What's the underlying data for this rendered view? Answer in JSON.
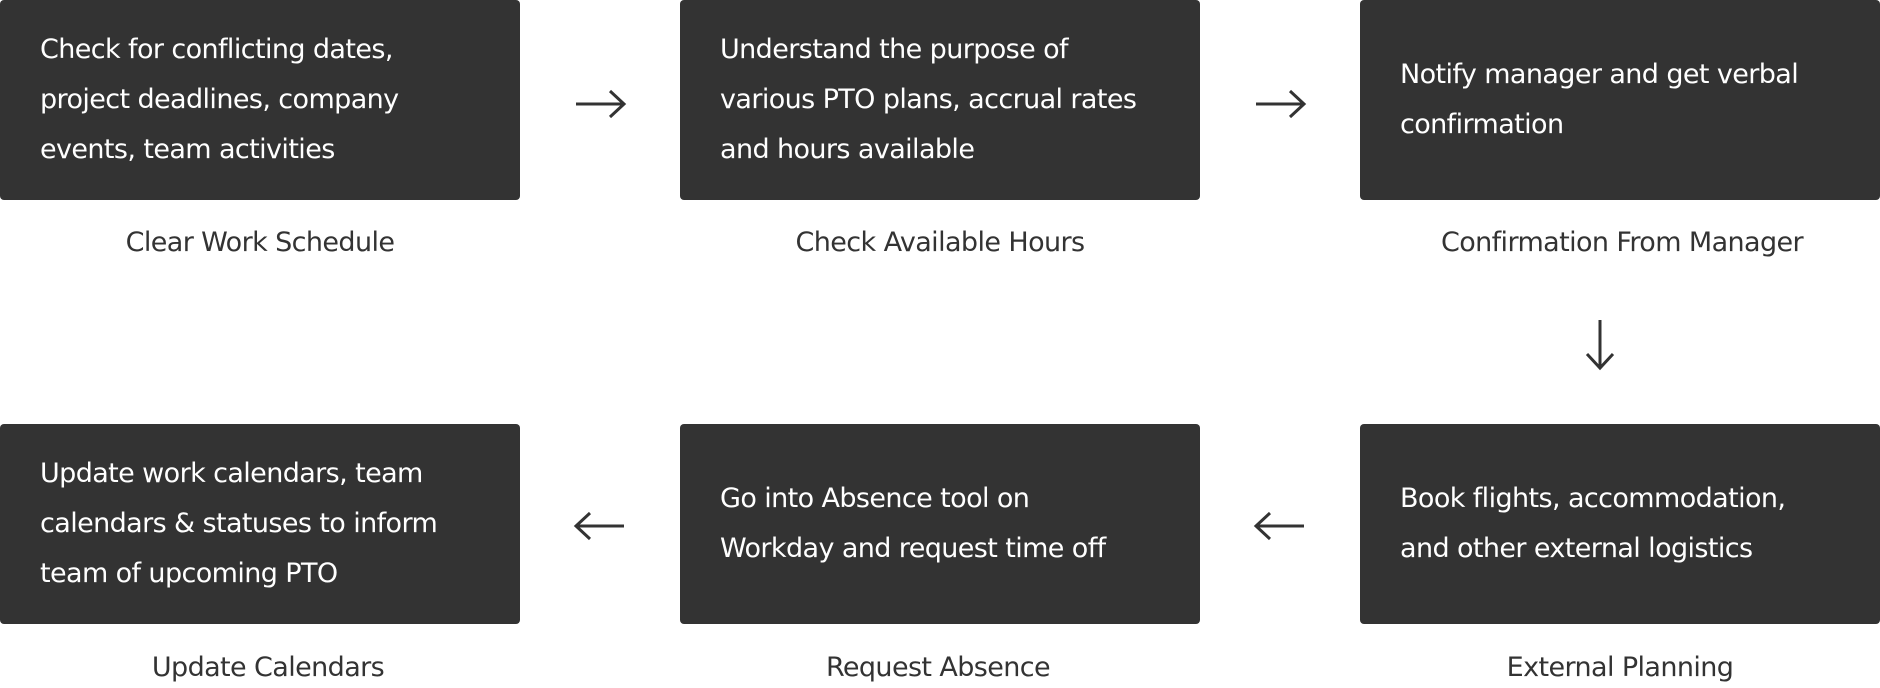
{
  "steps": [
    {
      "title": "Clear Work Schedule",
      "description": "Check for conflicting dates, project deadlines, company events, team activities"
    },
    {
      "title": "Check Available Hours",
      "description": "Understand the purpose of various PTO plans, accrual rates and hours available"
    },
    {
      "title": "Confirmation From Manager",
      "description": "Notify manager and get verbal confirmation"
    },
    {
      "title": "External Planning",
      "description": "Book flights, accommodation, and other external logistics"
    },
    {
      "title": "Request Absence",
      "description": "Go into Absence tool on Workday and request time off"
    },
    {
      "title": "Update Calendars",
      "description": "Update work calendars, team calendars & statuses to inform team of upcoming PTO"
    }
  ],
  "colors": {
    "box": "#333333",
    "text": "#ffffff",
    "label": "#333333"
  }
}
